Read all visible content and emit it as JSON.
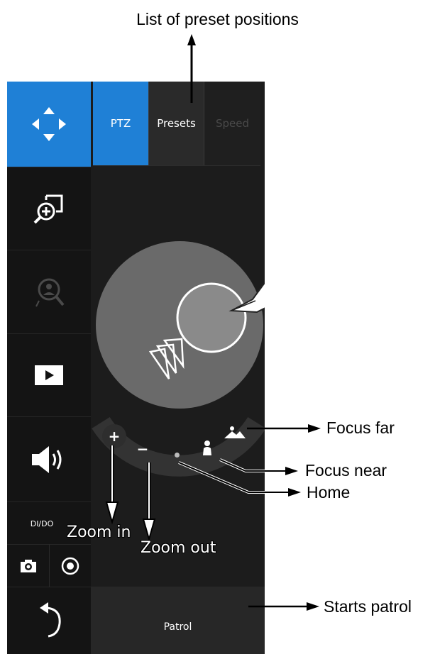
{
  "tabs": [
    {
      "label": "PTZ",
      "state": "active"
    },
    {
      "label": "Presets",
      "state": "normal"
    },
    {
      "label": "Speed",
      "state": "disabled"
    }
  ],
  "sidebar": {
    "items": [
      {
        "name": "ptz-move",
        "icon": "four-arrows-icon",
        "active": true
      },
      {
        "name": "digital-zoom",
        "icon": "zoom-region-icon"
      },
      {
        "name": "ptz-tracking",
        "icon": "person-zoom-icon",
        "disabled": true
      },
      {
        "name": "playback",
        "icon": "play-icon"
      },
      {
        "name": "audio",
        "icon": "speaker-icon"
      },
      {
        "name": "dido",
        "label": "DI/DO"
      },
      {
        "name": "snapshot",
        "icon": "camera-icon"
      },
      {
        "name": "record",
        "icon": "record-icon"
      },
      {
        "name": "back",
        "icon": "back-arrow-icon"
      }
    ]
  },
  "controls": {
    "zoom_in_symbol": "+",
    "zoom_out_symbol": "−",
    "patrol_label": "Patrol"
  },
  "annotations": {
    "presets_list": "List of preset positions",
    "focus_far": "Focus far",
    "focus_near": "Focus near",
    "home": "Home",
    "zoom_in": "Zoom in",
    "zoom_out": "Zoom out",
    "starts_patrol": "Starts patrol"
  },
  "colors": {
    "accent": "#1f80d6",
    "panel": "#1c1c1c",
    "sidebar": "#111111",
    "joystick": "#6b6b6b"
  }
}
